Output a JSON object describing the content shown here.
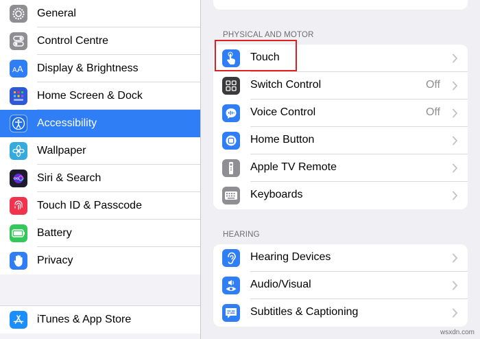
{
  "sidebar": {
    "items": [
      {
        "label": "General",
        "icon": "gear-icon",
        "color": "#8e8e93"
      },
      {
        "label": "Control Centre",
        "icon": "toggles-icon",
        "color": "#8e8e93"
      },
      {
        "label": "Display & Brightness",
        "icon": "text-size-icon",
        "color": "#2f7ef6"
      },
      {
        "label": "Home Screen & Dock",
        "icon": "app-grid-icon",
        "color": "#2f58d6"
      },
      {
        "label": "Accessibility",
        "icon": "accessibility-icon",
        "color": "#2f7ef6",
        "selected": true
      },
      {
        "label": "Wallpaper",
        "icon": "flower-icon",
        "color": "#35aadc"
      },
      {
        "label": "Siri & Search",
        "icon": "siri-icon",
        "color": "#1c1c2e"
      },
      {
        "label": "Touch ID & Passcode",
        "icon": "fingerprint-icon",
        "color": "#f0344d"
      },
      {
        "label": "Battery",
        "icon": "battery-icon",
        "color": "#34c759"
      },
      {
        "label": "Privacy",
        "icon": "hand-icon",
        "color": "#2f7ef6"
      }
    ],
    "store": {
      "label": "iTunes & App Store",
      "icon": "app-store-icon",
      "color": "#1c8ef9"
    }
  },
  "main": {
    "sections": [
      {
        "header": "PHYSICAL AND MOTOR",
        "rows": [
          {
            "label": "Touch",
            "value": "",
            "icon": "hand-point-icon",
            "color": "#2f7ef6"
          },
          {
            "label": "Switch Control",
            "value": "Off",
            "icon": "switch-grid-icon",
            "color": "#3a3a3c"
          },
          {
            "label": "Voice Control",
            "value": "Off",
            "icon": "voice-control-icon",
            "color": "#2f7ef6"
          },
          {
            "label": "Home Button",
            "value": "",
            "icon": "home-button-icon",
            "color": "#2f7ef6"
          },
          {
            "label": "Apple TV Remote",
            "value": "",
            "icon": "remote-icon",
            "color": "#8e8e93"
          },
          {
            "label": "Keyboards",
            "value": "",
            "icon": "keyboard-icon",
            "color": "#8e8e93"
          }
        ]
      },
      {
        "header": "HEARING",
        "rows": [
          {
            "label": "Hearing Devices",
            "value": "",
            "icon": "ear-icon",
            "color": "#2f7ef6"
          },
          {
            "label": "Audio/Visual",
            "value": "",
            "icon": "audio-visual-icon",
            "color": "#2f7ef6"
          },
          {
            "label": "Subtitles & Captioning",
            "value": "",
            "icon": "captions-icon",
            "color": "#2f7ef6"
          }
        ]
      }
    ]
  },
  "watermark": "wsxdn.com"
}
